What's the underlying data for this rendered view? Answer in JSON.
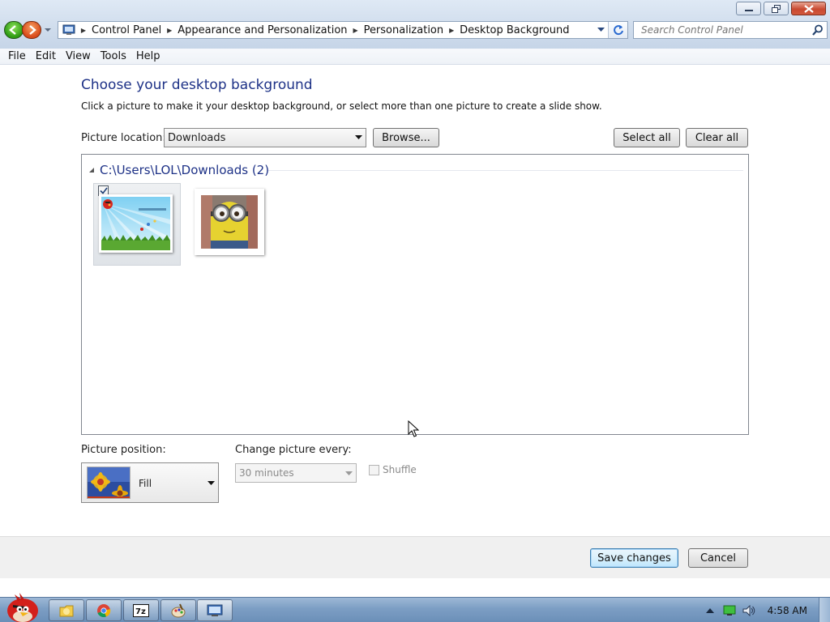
{
  "window": {
    "breadcrumbs": [
      "Control Panel",
      "Appearance and Personalization",
      "Personalization",
      "Desktop Background"
    ],
    "search_placeholder": "Search Control Panel"
  },
  "menu": [
    "File",
    "Edit",
    "View",
    "Tools",
    "Help"
  ],
  "page": {
    "title": "Choose your desktop background",
    "description": "Click a picture to make it your desktop background, or select more than one picture to create a slide show.",
    "picture_location_label": "Picture location:",
    "picture_location_value": "Downloads",
    "browse_label": "Browse...",
    "select_all_label": "Select all",
    "clear_all_label": "Clear all",
    "group_title": "C:\\Users\\LOL\\Downloads (2)",
    "pictures": [
      {
        "icon": "angry-birds-wallpaper",
        "selected": true
      },
      {
        "icon": "minion-photo",
        "selected": false
      }
    ],
    "picture_position_label": "Picture position:",
    "picture_position_value": "Fill",
    "change_picture_label": "Change picture every:",
    "change_picture_value": "30 minutes",
    "shuffle_label": "Shuffle",
    "shuffle_checked": false
  },
  "footer": {
    "save_label": "Save changes",
    "cancel_label": "Cancel"
  },
  "taskbar": {
    "apps": [
      "windows-explorer-icon",
      "chrome-icon",
      "7zip-icon",
      "paint-icon",
      "control-panel-icon"
    ],
    "clock": "4:58 AM"
  },
  "colors": {
    "title_blue": "#1e3287",
    "taskbar": "#7c9ec4"
  }
}
